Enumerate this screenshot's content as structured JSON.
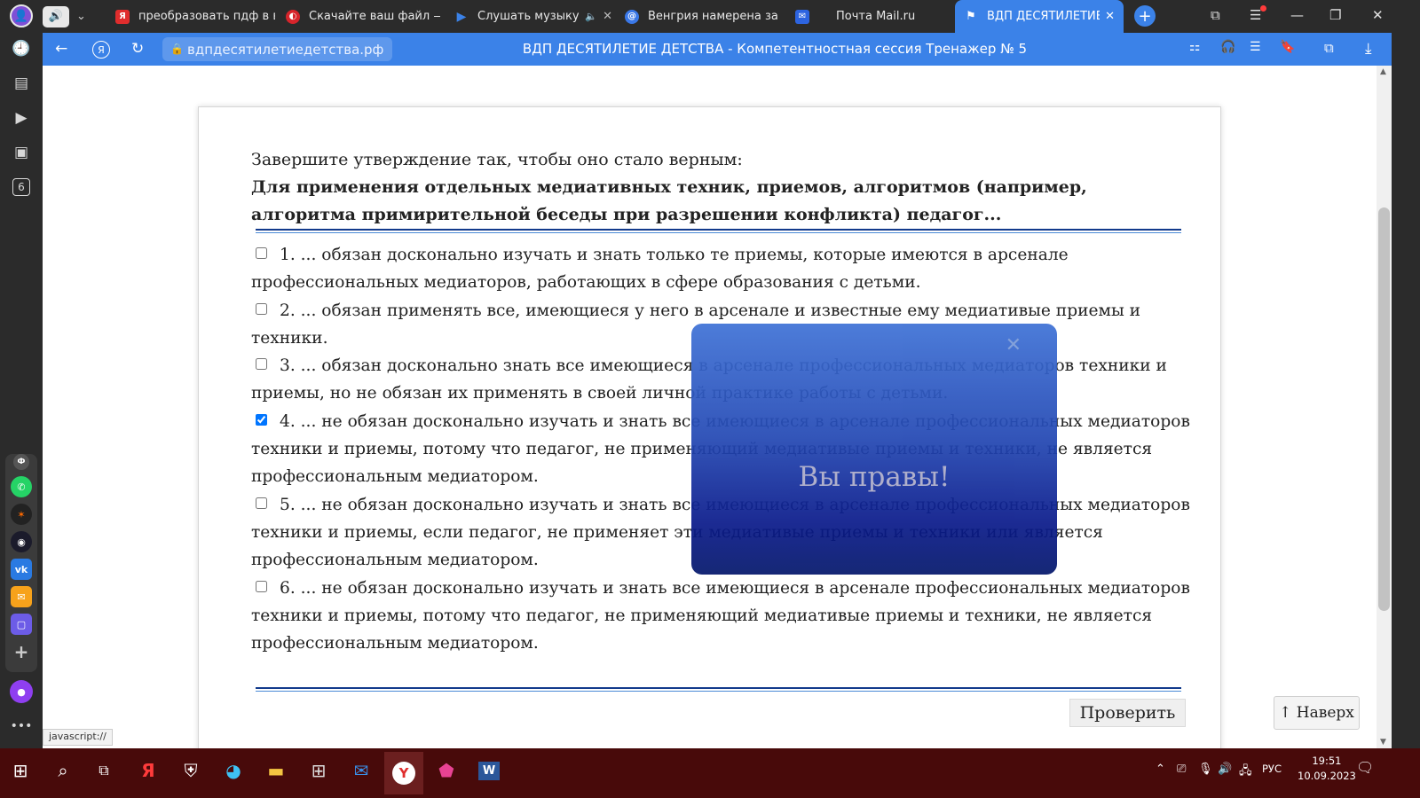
{
  "tabs": [
    {
      "title": "преобразовать пдф в вор",
      "favicon": "yandex-icon",
      "color": "#e02d2d"
    },
    {
      "title": "Скачайте ваш файл — Со",
      "favicon": "converter-icon",
      "color": "#d6242b"
    },
    {
      "title": "Слушать музыку бесп",
      "favicon": "play-icon",
      "color": "#2d64e0"
    },
    {
      "title": "Венгрия намерена замен",
      "favicon": "news-icon",
      "color": "#3a78e8"
    },
    {
      "title": "Почта Mail.ru",
      "favicon": "mail-icon",
      "color": "#2d64e0"
    },
    {
      "title": "ВДП ДЕСЯТИЛЕТИЕ ДЕТСТВА",
      "favicon": "site-icon",
      "color": "#3b82e8"
    }
  ],
  "address": {
    "url": "вдпдесятилетиедетства.рф",
    "title": "ВДП ДЕСЯТИЛЕТИЕ ДЕТСТВА - Компетентностная сессия Тренажер № 5"
  },
  "sidebar": {
    "badge": "6"
  },
  "question": {
    "intro": "Завершите утверждение так, чтобы оно стало верным:",
    "text": "Для применения отдельных медиативных техник, приемов, алгоритмов (например, алгоритма примирительной беседы при разрешении конфликта) педагог..."
  },
  "options": [
    {
      "label": "1. ... обязан досконально изучать и знать только те приемы, которые имеются в арсенале профессиональных медиаторов, работающих в сфере образования с детьми.",
      "checked": false
    },
    {
      "label": "2. ... обязан применять все, имеющиеся у него в арсенале и известные ему медиативые приемы и техники.",
      "checked": false
    },
    {
      "label": "3. ... обязан досконально знать все имеющиеся в арсенале профессиональных медиаторов техники и приемы, но не обязан их применять в своей личной практике работы с детьми.",
      "checked": false
    },
    {
      "label": "4. ... не обязан досконально изучать и знать все имеющиеся в арсенале профессиональных медиаторов техники и приемы, потому что педагог, не применяющий медиативые приемы и техники, не является профессиональным медиатором.",
      "checked": true
    },
    {
      "label": "5. ... не обязан досконально изучать и знать все имеющиеся в арсенале профессиональных медиаторов техники и приемы, если педагог, не применяет эти медиативые приемы и техники или является профессиональным медиатором.",
      "checked": false
    },
    {
      "label": "6. ... не обязан досконально изучать и знать все имеющиеся в арсенале профессиональных медиаторов техники и приемы, потому что педагог, не применяющий медиативые приемы и техники, не является профессиональным медиатором.",
      "checked": false
    }
  ],
  "buttons": {
    "check": "Проверить",
    "top": "↑ Наверх"
  },
  "modal": {
    "message": "Вы правы!"
  },
  "status": {
    "link": "javascript://"
  },
  "taskbar": {
    "lang": "РУС",
    "time": "19:51",
    "date": "10.09.2023"
  },
  "colors": {
    "accent": "#3b82e8",
    "taskbar": "#480a0a"
  }
}
